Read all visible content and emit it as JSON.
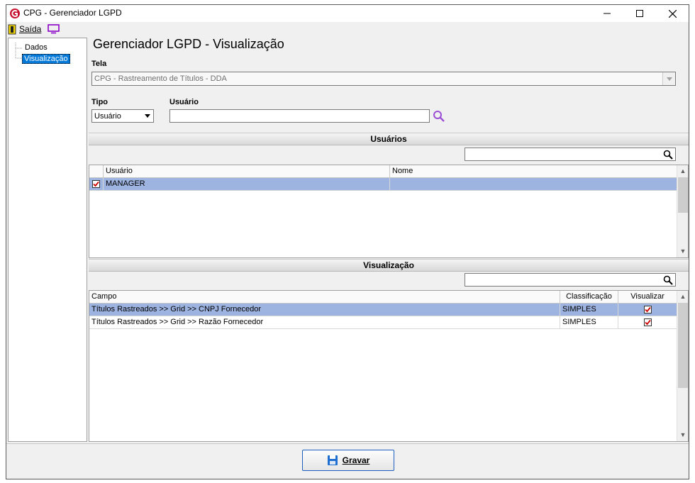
{
  "window": {
    "title": "CPG - Gerenciador LGPD"
  },
  "menu": {
    "exit_label": "Saída"
  },
  "tree": {
    "items": [
      {
        "label": "Dados"
      },
      {
        "label": "Visualização"
      }
    ]
  },
  "page": {
    "heading": "Gerenciador LGPD - Visualização"
  },
  "form": {
    "tela_label": "Tela",
    "tela_value": "CPG - Rastreamento de Títulos - DDA",
    "tipo_label": "Tipo",
    "tipo_value": "Usuário",
    "usuario_label": "Usuário",
    "usuario_value": ""
  },
  "usuarios_section": {
    "title": "Usuários",
    "filter_value": "",
    "columns": [
      "",
      "Usuário",
      "Nome"
    ],
    "rows": [
      {
        "checked": true,
        "usuario": "MANAGER",
        "nome": ""
      }
    ]
  },
  "visualizacao_section": {
    "title": "Visualização",
    "filter_value": "",
    "columns": [
      "Campo",
      "Classificação",
      "Visualizar"
    ],
    "rows": [
      {
        "campo": "Títulos Rastreados >> Grid >> CNPJ Fornecedor",
        "classificacao": "SIMPLES",
        "visualizar": true
      },
      {
        "campo": "Títulos Rastreados >> Grid >> Razão Fornecedor",
        "classificacao": "SIMPLES",
        "visualizar": true
      }
    ]
  },
  "footer": {
    "save_label": "Gravar"
  },
  "colors": {
    "selection": "#9db3e0",
    "button_border": "#1d5fbf",
    "search_icon": "#9b4fd6",
    "check_mark": "#cc0000"
  }
}
